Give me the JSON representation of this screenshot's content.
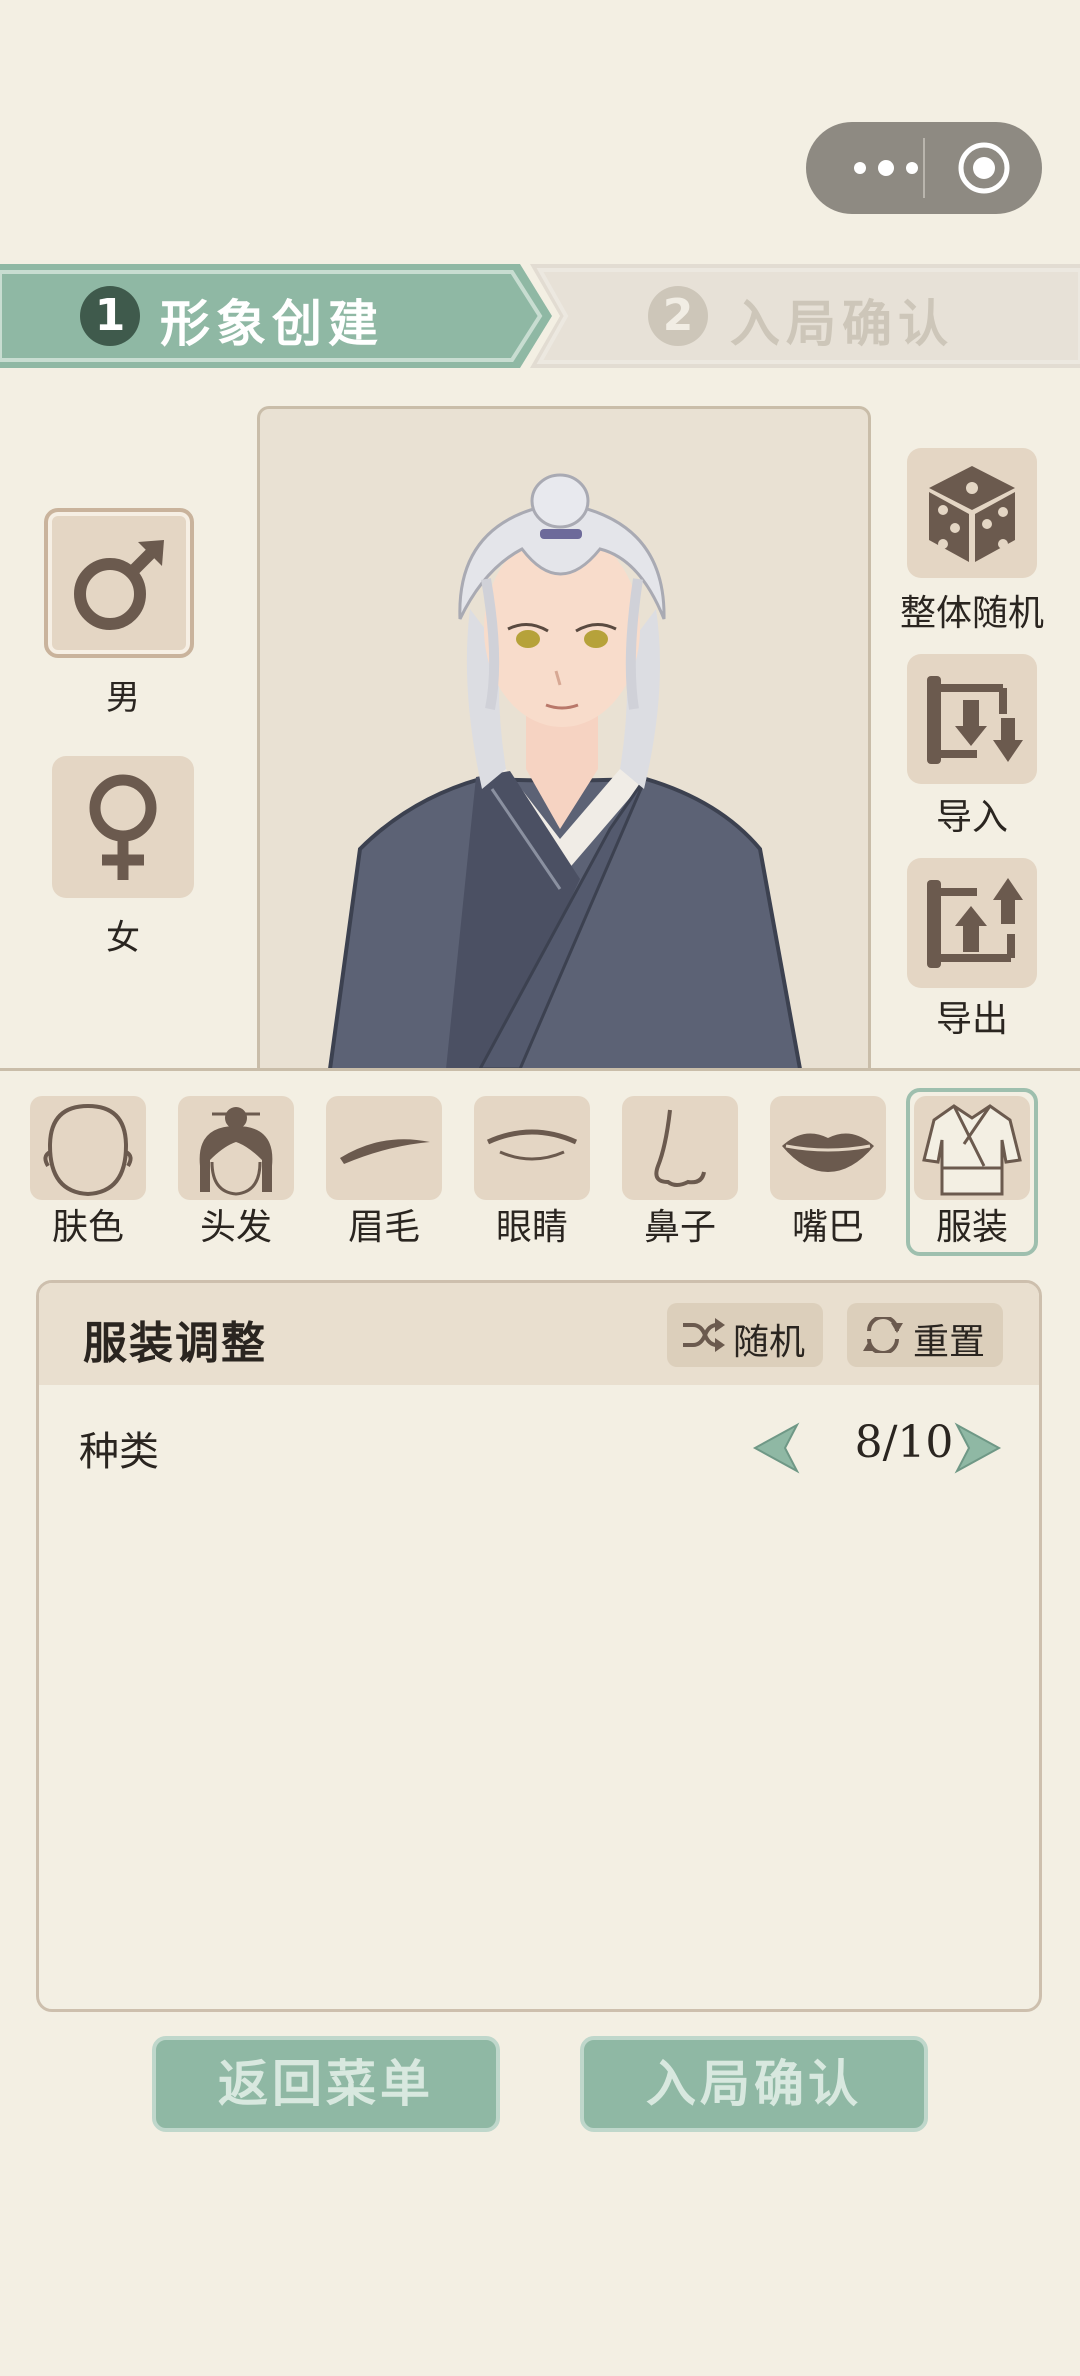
{
  "capsule": {
    "more_icon": "more-dots-icon",
    "record_icon": "record-icon"
  },
  "tabs": [
    {
      "num": "1",
      "label": "形象创建",
      "active": true
    },
    {
      "num": "2",
      "label": "入局确认",
      "active": false
    }
  ],
  "gender": [
    {
      "label": "男",
      "icon": "male-symbol-icon",
      "selected": true
    },
    {
      "label": "女",
      "icon": "female-symbol-icon",
      "selected": false
    }
  ],
  "actions": [
    {
      "label": "整体随机",
      "icon": "dice-icon"
    },
    {
      "label": "导入",
      "icon": "import-scroll-icon"
    },
    {
      "label": "导出",
      "icon": "export-scroll-icon"
    }
  ],
  "features": [
    {
      "label": "肤色",
      "icon": "face-outline-icon"
    },
    {
      "label": "头发",
      "icon": "hair-bun-icon"
    },
    {
      "label": "眉毛",
      "icon": "eyebrow-icon"
    },
    {
      "label": "眼睛",
      "icon": "eye-icon"
    },
    {
      "label": "鼻子",
      "icon": "nose-icon"
    },
    {
      "label": "嘴巴",
      "icon": "lips-icon"
    },
    {
      "label": "服装",
      "icon": "robe-icon",
      "selected": true
    }
  ],
  "panel": {
    "title": "服装调整",
    "random_label": "随机",
    "reset_label": "重置",
    "row_label": "种类",
    "row_value": "8/10"
  },
  "bottom": {
    "back_label": "返回菜单",
    "confirm_label": "入局确认"
  },
  "colors": {
    "background": "#f3efe3",
    "accent_green": "#8fb8a4",
    "tile": "#e4d6c4",
    "icon_brown": "#6b5a4e"
  }
}
